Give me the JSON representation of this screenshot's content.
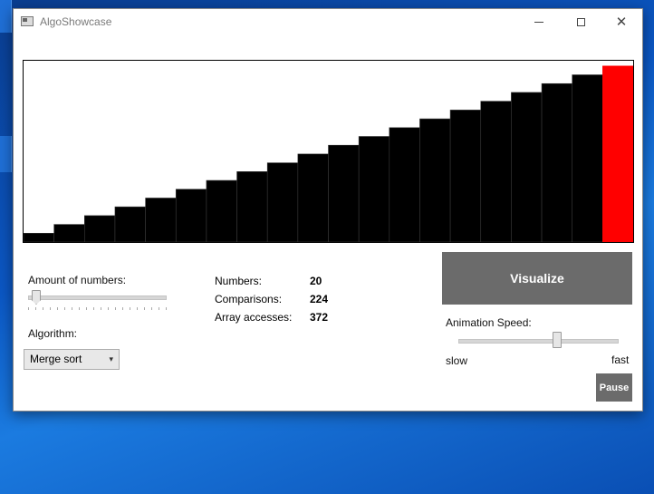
{
  "window": {
    "title": "AlgoShowcase"
  },
  "controls": {
    "amount_label": "Amount of numbers:",
    "amount_value": 20,
    "algorithm_label": "Algorithm:",
    "algorithm_selected": "Merge sort",
    "visualize_label": "Visualize",
    "speed_label": "Animation Speed:",
    "speed_slow": "slow",
    "speed_fast": "fast",
    "speed_fraction": 0.62,
    "pause_label": "Pause"
  },
  "stats": {
    "numbers_label": "Numbers:",
    "numbers_value": "20",
    "comparisons_label": "Comparisons:",
    "comparisons_value": "224",
    "accesses_label": "Array accesses:",
    "accesses_value": "372"
  },
  "colors": {
    "bar": "#000000",
    "active_bar": "#ff0000",
    "button": "#6b6b6b"
  },
  "chart_data": {
    "type": "bar",
    "values": [
      1,
      2,
      3,
      4,
      5,
      6,
      7,
      8,
      9,
      10,
      11,
      12,
      13,
      14,
      15,
      16,
      17,
      18,
      19,
      20
    ],
    "highlight_index": 19,
    "ylim": [
      0,
      20.6
    ]
  }
}
